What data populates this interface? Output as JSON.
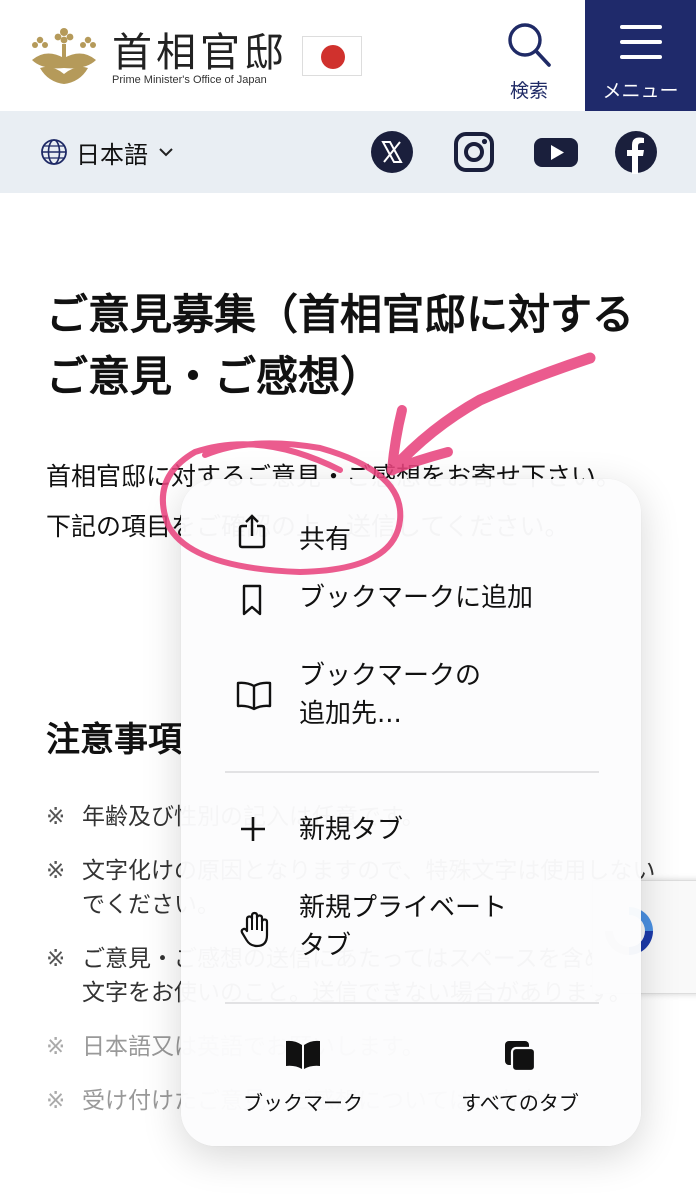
{
  "header": {
    "title": "首相官邸",
    "subtitle": "Prime Minister's Office of Japan",
    "search_label": "検索",
    "menu_label": "メニュー"
  },
  "subbar": {
    "language": "日本語",
    "social": [
      "x-icon",
      "instagram-icon",
      "youtube-icon",
      "facebook-icon"
    ]
  },
  "main": {
    "title": "ご意見募集（首相官邸に対するご意見・ご感想）",
    "intro": [
      "首相官邸に対するご意見・ご感想をお寄せ下さい。",
      "下記の項目をご確認の上、送信してください。"
    ],
    "section_heading": "注意事項",
    "notes_mark": "※",
    "notes": [
      "年齢及び性別の記入は任意です。",
      "文字化けの原因となりますので、特殊文字は使用しないでください。",
      "ご意見・ご感想の送信にあたってはスペースを含め全角文字をお使いのこと。送信できない場合があります。",
      "日本語又は英語でお願いします。",
      "受け付けたご意見・ご感想については、内容に"
    ]
  },
  "context_menu": {
    "items": [
      {
        "label": "共有",
        "icon": "share-icon"
      },
      {
        "label": "ブックマークに追加",
        "icon": "bookmark-icon"
      },
      {
        "label": "ブックマークの\n追加先...",
        "icon": "book-icon"
      },
      {
        "label": "新規タブ",
        "icon": "plus-icon"
      },
      {
        "label": "新規プライベート\nタブ",
        "icon": "hand-icon"
      }
    ],
    "bottom": [
      {
        "label": "ブックマーク",
        "icon": "bookmarks-icon"
      },
      {
        "label": "すべてのタブ",
        "icon": "tabs-icon"
      }
    ]
  },
  "colors": {
    "navy": "#1f2a6b",
    "flag_red": "#d0312d",
    "annotation_pink": "#e8447e",
    "subbar_bg": "#e9eef3",
    "emblem_gold": "#b59a5a"
  }
}
